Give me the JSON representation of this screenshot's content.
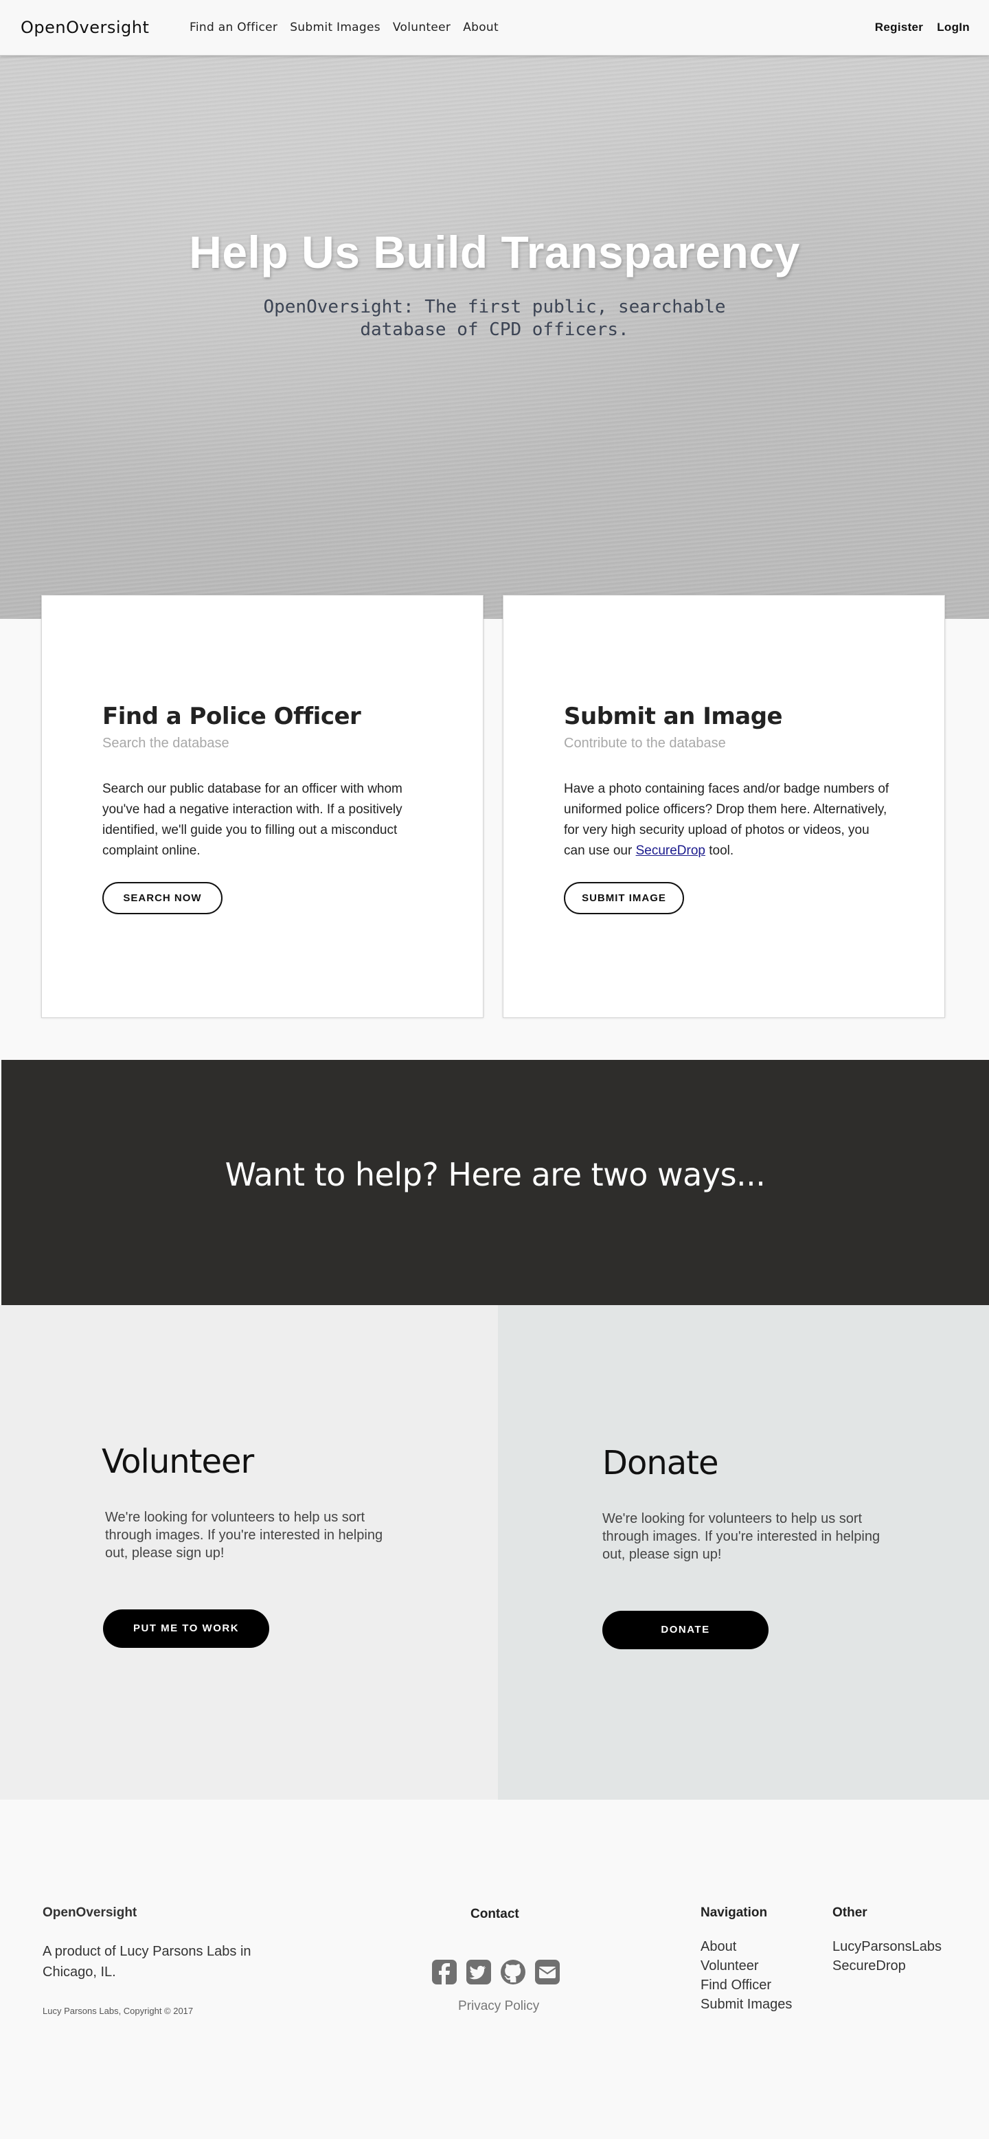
{
  "nav": {
    "brand": "OpenOversight",
    "links": [
      "Find an Officer",
      "Submit Images",
      "Volunteer",
      "About"
    ],
    "register": "Register",
    "login": "LogIn"
  },
  "hero": {
    "title": "Help Us Build Transparency",
    "subtitle": "OpenOversight: The first public, searchable database of CPD officers."
  },
  "cards": {
    "find": {
      "title": "Find a Police Officer",
      "subtitle": "Search the database",
      "text": "Search our public database for an officer with whom you've had a negative interaction with. If a positively identified, we'll guide you to filling out a misconduct complaint online.",
      "button": "SEARCH NOW"
    },
    "submit": {
      "title": "Submit an Image",
      "subtitle": "Contribute to the database",
      "text_before": "Have a photo containing faces and/or badge numbers of uniformed police officers? Drop them here. Alternatively, for very high security upload of photos or videos, you can use our ",
      "link": "SecureDrop",
      "text_after": " tool.",
      "button": "SUBMIT IMAGE"
    }
  },
  "help": {
    "title": "Want to help? Here are two ways..."
  },
  "volunteer": {
    "title": "Volunteer",
    "text": "We're looking for volunteers to help us sort through images. If you're interested in helping out, please sign up!",
    "button": "PUT ME TO WORK"
  },
  "donate": {
    "title": "Donate",
    "text": "We're looking for volunteers to help us sort through images. If you're interested in helping out, please sign up!",
    "button": "DONATE"
  },
  "footer": {
    "brand": "OpenOversight",
    "description": "A product of Lucy Parsons Labs in Chicago, IL.",
    "copyright": "Lucy Parsons Labs, Copyright © 2017",
    "contact_title": "Contact",
    "social_icons": [
      "facebook-icon",
      "twitter-icon",
      "github-icon",
      "email-icon"
    ],
    "privacy": "Privacy Policy",
    "navigation_title": "Navigation",
    "navigation": [
      "About",
      "Volunteer",
      "Find Officer",
      "Submit Images"
    ],
    "other_title": "Other",
    "other": [
      "LucyParsonsLabs",
      "SecureDrop"
    ]
  },
  "colors": {
    "help_band": "#2e2d2b",
    "volunteer_bg": "#eeeeee",
    "donate_bg": "#e2e5e5",
    "button_black": "#000000",
    "hero_gray": "#c6c6c6"
  }
}
